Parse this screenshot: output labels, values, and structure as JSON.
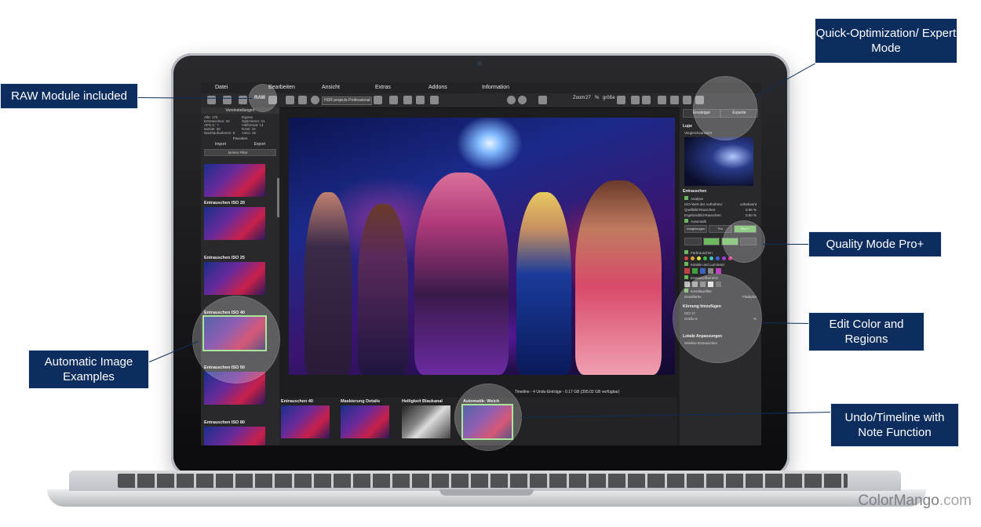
{
  "app": {
    "menu": [
      "Datei",
      "Bearbeiten",
      "Ansicht",
      "Extras",
      "Addons",
      "Information"
    ],
    "toolbar": {
      "raw_label": "RAW",
      "profile_combo": "HDR projects Professional",
      "zoom_label": "Zoom",
      "zoom_value": "27",
      "zoom_unit": "%",
      "size_label": "größe"
    },
    "left_panel": {
      "header": "Voreinstellungen",
      "stats": [
        "Alle: 175",
        "Eigene",
        "Entrauschen: 32",
        "Optimieren: 21",
        "APS-C: 7",
        "Vollformat: 14",
        "Mobile: 36",
        "RAW: 32",
        "Nachtaufnahmen: 8",
        "Astro: 15"
      ],
      "favorites": "Favoriten",
      "import_label": "Import",
      "export_label": "Export",
      "filter_placeholder": "keinen Filter",
      "presets": [
        "Entrauschen ISO 20",
        "Entrauschen ISO 25",
        "Entrauschen ISO 40",
        "Entrauschen ISO 50",
        "Entrauschen ISO 80"
      ]
    },
    "timeline": {
      "status": "Timeline - 4 Undo-Einträge - 0.17 GB (395.02 GB verfügbar)",
      "frames": [
        "Entrauschen 40",
        "Maskierung Details",
        "Helligkeit Blaukanal",
        "Automatik: Weich"
      ]
    },
    "right_panel": {
      "tab_simple": "Einsteiger",
      "tab_expert": "Experte",
      "loupe": "Lupe",
      "compare": "Vergleichsansicht",
      "denoise_title": "Entrauschen",
      "analysis": "Analyse",
      "iso_label": "ISO-Wert der Aufnahme:",
      "iso_value": "unbekannt",
      "source_noise_label": "Quellbild-Rauschen:",
      "source_noise_value": "0.96 %",
      "result_noise_label": "Ergebnisbild-Rauschen:",
      "result_noise_value": "0.80 %",
      "automatic": "Automatik",
      "mode_balanced": "Ausgewogen",
      "mode_pro": "Pro",
      "mode_proplus": "Pro +",
      "color_noise": "Farbrauschen",
      "edges_luminance": "Kanäle und Luminanz",
      "denoise_area": "Entrauschbereich",
      "correction_filter": "Korrekturfilter",
      "detail_label": "Detailfarbe",
      "flat_label": "Flatfarbe",
      "grain_title": "Körnung hinzufügen",
      "iso_17": "ISO 17",
      "size_5": "Größe 5",
      "percent": "%",
      "local_adjust": "Lokale Anpassungen",
      "selective_denoise": "Selektiv Entrauschen"
    }
  },
  "callouts": {
    "raw": "RAW Module included",
    "quick": "Quick-Optimization/ Expert Mode",
    "quality": "Quality Mode Pro+",
    "edit_color": "Edit Color and Regions",
    "auto_examples": "Automatic Image Examples",
    "undo": "Undo/Timeline with Note Function"
  },
  "brand": {
    "name": "ColorMango",
    "suffix": ".com"
  },
  "colors": {
    "callout_bg": "#0d2d5e",
    "accent_green": "#6bb85a",
    "brand_gray": "#7c7f84"
  }
}
